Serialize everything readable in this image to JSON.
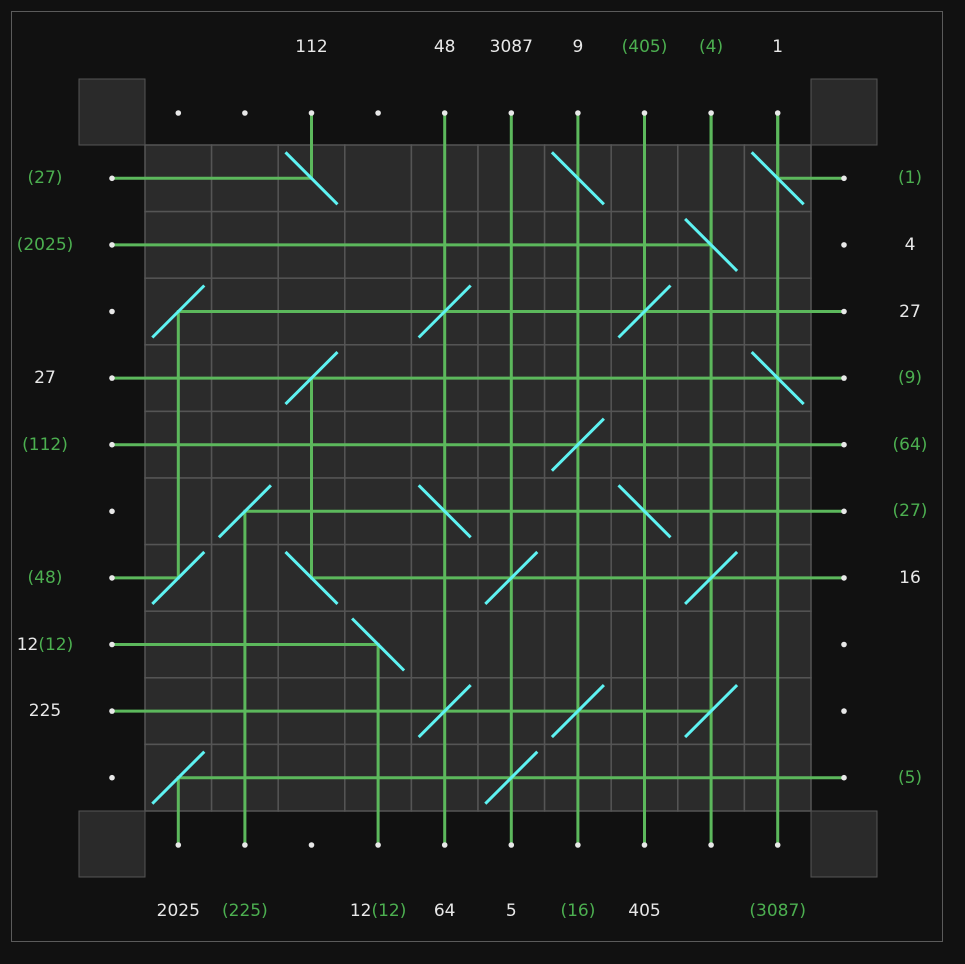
{
  "colors": {
    "background": "#111111",
    "grid_fill": "#2b2b2b",
    "grid_line": "#555555",
    "corner_box": "#2a2a2a",
    "beam": "#5cb85c",
    "mirror": "#5ef2f2",
    "dot": "#e8e8e8",
    "label_white": "#e8e8e8",
    "label_green": "#4caf50"
  },
  "board": {
    "rows": 10,
    "cols": 10,
    "mirrors": [
      {
        "r": 0,
        "c": 2,
        "type": "\\"
      },
      {
        "r": 0,
        "c": 6,
        "type": "\\"
      },
      {
        "r": 0,
        "c": 9,
        "type": "\\"
      },
      {
        "r": 1,
        "c": 8,
        "type": "\\"
      },
      {
        "r": 2,
        "c": 0,
        "type": "/"
      },
      {
        "r": 2,
        "c": 4,
        "type": "/"
      },
      {
        "r": 2,
        "c": 7,
        "type": "/"
      },
      {
        "r": 3,
        "c": 2,
        "type": "/"
      },
      {
        "r": 3,
        "c": 9,
        "type": "\\"
      },
      {
        "r": 4,
        "c": 6,
        "type": "/"
      },
      {
        "r": 5,
        "c": 1,
        "type": "/"
      },
      {
        "r": 5,
        "c": 4,
        "type": "\\"
      },
      {
        "r": 5,
        "c": 7,
        "type": "\\"
      },
      {
        "r": 6,
        "c": 0,
        "type": "/"
      },
      {
        "r": 6,
        "c": 2,
        "type": "\\"
      },
      {
        "r": 6,
        "c": 5,
        "type": "/"
      },
      {
        "r": 6,
        "c": 8,
        "type": "/"
      },
      {
        "r": 7,
        "c": 3,
        "type": "\\"
      },
      {
        "r": 8,
        "c": 4,
        "type": "/"
      },
      {
        "r": 8,
        "c": 6,
        "type": "/"
      },
      {
        "r": 8,
        "c": 8,
        "type": "/"
      },
      {
        "r": 9,
        "c": 0,
        "type": "/"
      },
      {
        "r": 9,
        "c": 5,
        "type": "/"
      }
    ],
    "beams": [
      {
        "from": [
          "L",
          0
        ],
        "to": [
          "T",
          2
        ],
        "path": [
          [
            "L",
            0
          ],
          [
            0,
            2
          ],
          [
            "T",
            2
          ]
        ]
      },
      {
        "from": [
          "R",
          0
        ],
        "to": [
          "T",
          9
        ],
        "path": [
          [
            "R",
            0
          ],
          [
            0,
            9
          ],
          [
            "T",
            9
          ]
        ]
      },
      {
        "from": [
          "T",
          6
        ],
        "to": [
          "B",
          6
        ],
        "path": [
          [
            "T",
            6
          ],
          [
            0,
            6
          ],
          [
            "B",
            6
          ]
        ]
      },
      {
        "from": [
          "L",
          1
        ],
        "to": [
          "T",
          8
        ],
        "path": [
          [
            "L",
            1
          ],
          [
            1,
            8
          ],
          [
            "T",
            8
          ]
        ]
      },
      {
        "from": [
          "T",
          8
        ],
        "to": [
          "B",
          8
        ],
        "path": [
          [
            "T",
            8
          ],
          [
            1,
            8
          ],
          [
            6,
            8
          ],
          [
            8,
            8
          ],
          [
            "B",
            8
          ]
        ]
      },
      {
        "from": [
          "R",
          2
        ],
        "to": [
          "B",
          0
        ],
        "path": [
          [
            "R",
            2
          ],
          [
            2,
            0
          ],
          [
            6,
            0
          ],
          [
            "L",
            6
          ]
        ]
      },
      {
        "from": [
          "T",
          4
        ],
        "to": [
          "B",
          4
        ],
        "path": [
          [
            "T",
            4
          ],
          [
            "B",
            4
          ]
        ]
      },
      {
        "from": [
          "T",
          5
        ],
        "to": [
          "B",
          5
        ],
        "path": [
          [
            "T",
            5
          ],
          [
            "B",
            5
          ]
        ]
      },
      {
        "from": [
          "T",
          7
        ],
        "to": [
          "B",
          7
        ],
        "path": [
          [
            "T",
            7
          ],
          [
            "B",
            7
          ]
        ]
      },
      {
        "from": [
          "L",
          3
        ],
        "to": [
          "R",
          3
        ],
        "path": [
          [
            "L",
            3
          ],
          [
            "R",
            3
          ]
        ]
      },
      {
        "from": [
          "L",
          4
        ],
        "to": [
          "R",
          4
        ],
        "path": [
          [
            "L",
            4
          ],
          [
            "R",
            4
          ]
        ]
      },
      {
        "from": [
          "R",
          5
        ],
        "to": [
          "B",
          1
        ],
        "path": [
          [
            "R",
            5
          ],
          [
            5,
            1
          ],
          [
            "B",
            1
          ]
        ]
      },
      {
        "from": [
          "R",
          6
        ],
        "to": [
          "T",
          2
        ],
        "path": [
          [
            "R",
            6
          ],
          [
            6,
            2
          ],
          [
            3,
            2
          ]
        ]
      },
      {
        "from": [
          "L",
          7
        ],
        "to": [
          "B",
          3
        ],
        "path": [
          [
            "L",
            7
          ],
          [
            7,
            3
          ],
          [
            "B",
            3
          ]
        ]
      },
      {
        "from": [
          "L",
          8
        ],
        "to": [
          "T",
          8
        ],
        "path": [
          [
            "L",
            8
          ],
          [
            8,
            8
          ],
          [
            6,
            8
          ]
        ]
      },
      {
        "from": [
          "R",
          9
        ],
        "to": [
          "B",
          0
        ],
        "path": [
          [
            "R",
            9
          ],
          [
            9,
            0
          ],
          [
            "B",
            0
          ]
        ]
      },
      {
        "from": [
          "T",
          9
        ],
        "to": [
          "B",
          9
        ],
        "path": [
          [
            "T",
            9
          ],
          [
            "B",
            9
          ]
        ]
      }
    ]
  },
  "clues": {
    "top": [
      {
        "col": 0,
        "parts": []
      },
      {
        "col": 1,
        "parts": []
      },
      {
        "col": 2,
        "parts": [
          {
            "t": "112",
            "g": false
          }
        ]
      },
      {
        "col": 3,
        "parts": []
      },
      {
        "col": 4,
        "parts": [
          {
            "t": "48",
            "g": false
          }
        ]
      },
      {
        "col": 5,
        "parts": [
          {
            "t": "3087",
            "g": false
          }
        ]
      },
      {
        "col": 6,
        "parts": [
          {
            "t": "9",
            "g": false
          }
        ]
      },
      {
        "col": 7,
        "parts": [
          {
            "t": "(405)",
            "g": true
          }
        ]
      },
      {
        "col": 8,
        "parts": [
          {
            "t": "(4)",
            "g": true
          }
        ]
      },
      {
        "col": 9,
        "parts": [
          {
            "t": "1",
            "g": false
          }
        ]
      }
    ],
    "bottom": [
      {
        "col": 0,
        "parts": [
          {
            "t": "2025",
            "g": false
          }
        ]
      },
      {
        "col": 1,
        "parts": [
          {
            "t": "(225)",
            "g": true
          }
        ]
      },
      {
        "col": 2,
        "parts": []
      },
      {
        "col": 3,
        "parts": [
          {
            "t": "12",
            "g": false
          },
          {
            "t": "(12)",
            "g": true
          }
        ]
      },
      {
        "col": 4,
        "parts": [
          {
            "t": "64",
            "g": false
          }
        ]
      },
      {
        "col": 5,
        "parts": [
          {
            "t": "5",
            "g": false
          }
        ]
      },
      {
        "col": 6,
        "parts": [
          {
            "t": "(16)",
            "g": true
          }
        ]
      },
      {
        "col": 7,
        "parts": [
          {
            "t": "405",
            "g": false
          }
        ]
      },
      {
        "col": 8,
        "parts": []
      },
      {
        "col": 9,
        "parts": [
          {
            "t": "(3087)",
            "g": true
          }
        ]
      }
    ],
    "left": [
      {
        "row": 0,
        "parts": [
          {
            "t": "(27)",
            "g": true
          }
        ]
      },
      {
        "row": 1,
        "parts": [
          {
            "t": "(2025)",
            "g": true
          }
        ]
      },
      {
        "row": 2,
        "parts": []
      },
      {
        "row": 3,
        "parts": [
          {
            "t": "27",
            "g": false
          }
        ]
      },
      {
        "row": 4,
        "parts": [
          {
            "t": "(112)",
            "g": true
          }
        ]
      },
      {
        "row": 5,
        "parts": []
      },
      {
        "row": 6,
        "parts": [
          {
            "t": "(48)",
            "g": true
          }
        ]
      },
      {
        "row": 7,
        "parts": [
          {
            "t": "12",
            "g": false
          },
          {
            "t": "(12)",
            "g": true
          }
        ]
      },
      {
        "row": 8,
        "parts": [
          {
            "t": "225",
            "g": false
          }
        ]
      },
      {
        "row": 9,
        "parts": []
      }
    ],
    "right": [
      {
        "row": 0,
        "parts": [
          {
            "t": "(1)",
            "g": true
          }
        ]
      },
      {
        "row": 1,
        "parts": [
          {
            "t": "4",
            "g": false
          }
        ]
      },
      {
        "row": 2,
        "parts": [
          {
            "t": "27",
            "g": false
          }
        ]
      },
      {
        "row": 3,
        "parts": [
          {
            "t": "(9)",
            "g": true
          }
        ]
      },
      {
        "row": 4,
        "parts": [
          {
            "t": "(64)",
            "g": true
          }
        ]
      },
      {
        "row": 5,
        "parts": [
          {
            "t": "(27)",
            "g": true
          }
        ]
      },
      {
        "row": 6,
        "parts": [
          {
            "t": "16",
            "g": false
          }
        ]
      },
      {
        "row": 7,
        "parts": []
      },
      {
        "row": 8,
        "parts": []
      },
      {
        "row": 9,
        "parts": [
          {
            "t": "(5)",
            "g": true
          }
        ]
      }
    ]
  }
}
